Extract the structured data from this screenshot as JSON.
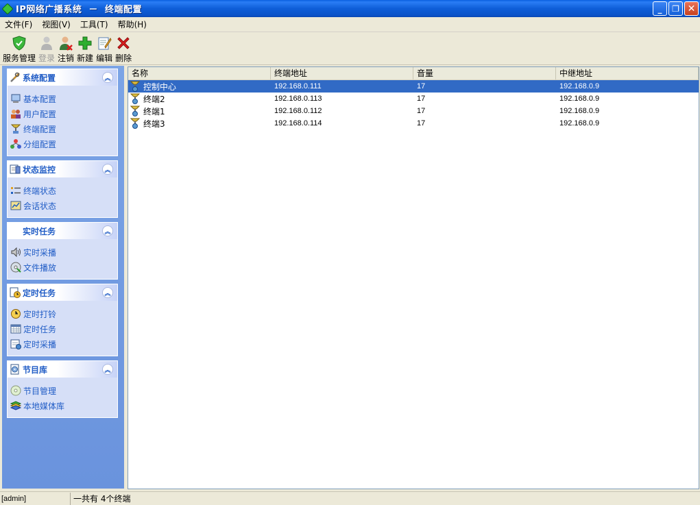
{
  "window": {
    "title": "IP网络广播系统  －  终端配置"
  },
  "menu": [
    {
      "label": "文件(F)"
    },
    {
      "label": "视图(V)"
    },
    {
      "label": "工具(T)"
    },
    {
      "label": "帮助(H)"
    }
  ],
  "toolbar": [
    {
      "label": "服务管理",
      "icon": "shield-icon",
      "enabled": true
    },
    {
      "label": "登录",
      "icon": "user-login-icon",
      "enabled": false
    },
    {
      "label": "注销",
      "icon": "user-logout-icon",
      "enabled": true
    },
    {
      "label": "新建",
      "icon": "plus-icon",
      "enabled": true
    },
    {
      "label": "编辑",
      "icon": "edit-icon",
      "enabled": true
    },
    {
      "label": "删除",
      "icon": "delete-icon",
      "enabled": true
    }
  ],
  "sidebar": {
    "panels": [
      {
        "title": "系统配置",
        "icon": "tools-icon",
        "items": [
          {
            "label": "基本配置",
            "icon": "computer-icon"
          },
          {
            "label": "用户配置",
            "icon": "users-icon"
          },
          {
            "label": "终端配置",
            "icon": "terminal-icon"
          },
          {
            "label": "分组配置",
            "icon": "group-icon"
          }
        ]
      },
      {
        "title": "状态监控",
        "icon": "monitor-icon",
        "items": [
          {
            "label": "终端状态",
            "icon": "status-list-icon"
          },
          {
            "label": "会话状态",
            "icon": "session-icon"
          }
        ]
      },
      {
        "title": "实时任务",
        "icon": "",
        "items": [
          {
            "label": "实时采播",
            "icon": "speaker-icon"
          },
          {
            "label": "文件播放",
            "icon": "disc-icon"
          }
        ]
      },
      {
        "title": "定时任务",
        "icon": "clock-doc-icon",
        "items": [
          {
            "label": "定时打铃",
            "icon": "alarm-clock-icon"
          },
          {
            "label": "定时任务",
            "icon": "calendar-icon"
          },
          {
            "label": "定时采播",
            "icon": "schedule-icon"
          }
        ]
      },
      {
        "title": "节目库",
        "icon": "library-icon",
        "items": [
          {
            "label": "节目管理",
            "icon": "cd-icon"
          },
          {
            "label": "本地媒体库",
            "icon": "media-stack-icon"
          }
        ]
      }
    ]
  },
  "table": {
    "columns": [
      "名称",
      "终端地址",
      "音量",
      "中继地址"
    ],
    "rows": [
      {
        "name": "控制中心",
        "address": "192.168.0.111",
        "volume": "17",
        "relay": "192.168.0.9",
        "selected": true
      },
      {
        "name": "终端2",
        "address": "192.168.0.113",
        "volume": "17",
        "relay": "192.168.0.9",
        "selected": false
      },
      {
        "name": "终端1",
        "address": "192.168.0.112",
        "volume": "17",
        "relay": "192.168.0.9",
        "selected": false
      },
      {
        "name": "终端3",
        "address": "192.168.0.114",
        "volume": "17",
        "relay": "192.168.0.9",
        "selected": false
      }
    ]
  },
  "status": {
    "user": "[admin]",
    "message": "一共有 4个终端"
  }
}
